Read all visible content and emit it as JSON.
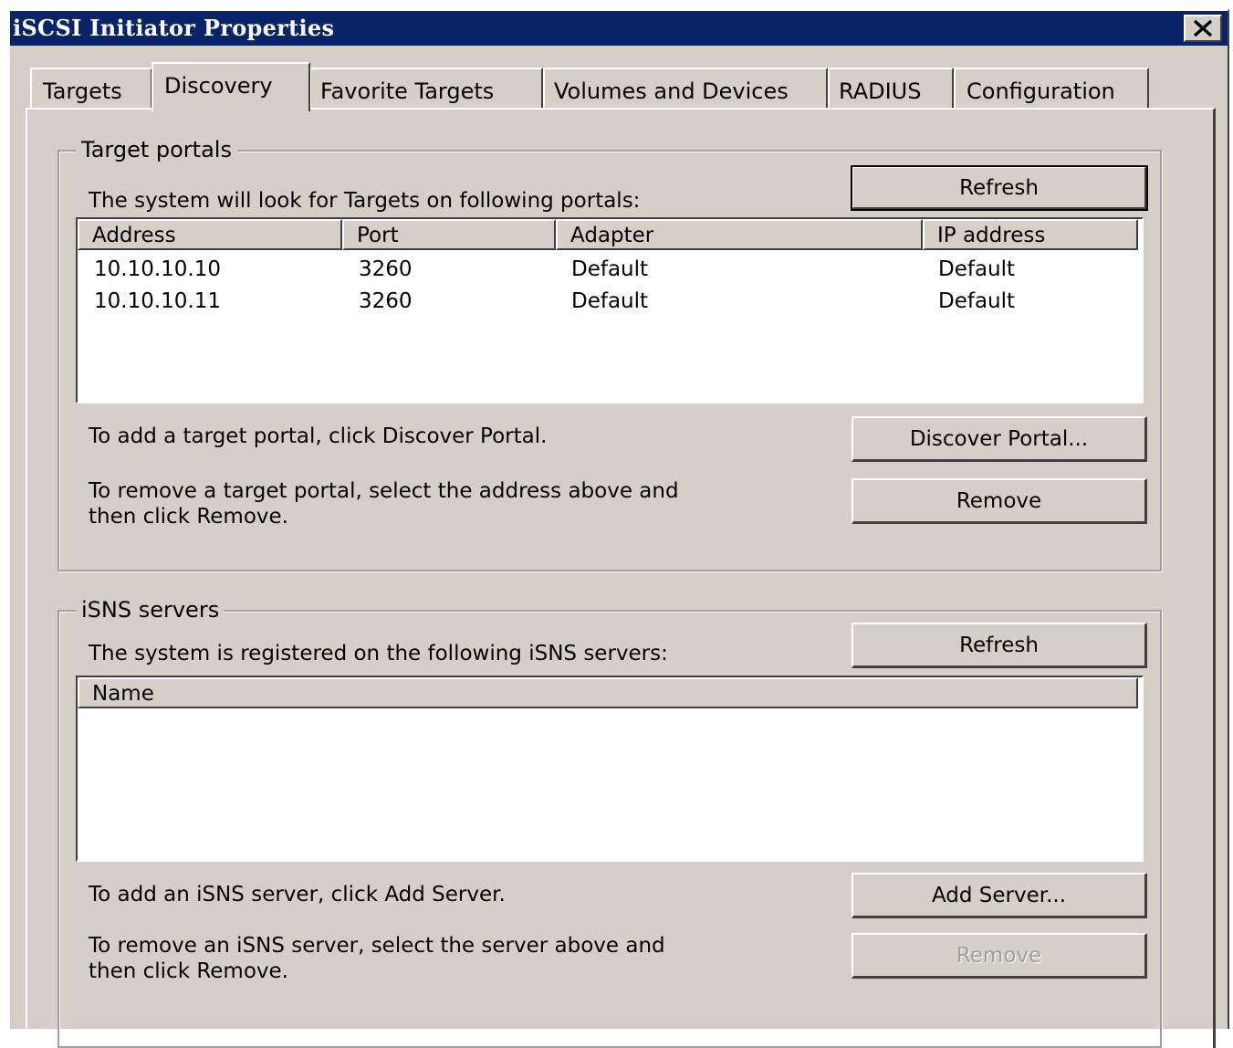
{
  "window": {
    "title": "iSCSI Initiator Properties",
    "close_glyph": "✕"
  },
  "tabs": [
    {
      "label": "Targets",
      "active": false
    },
    {
      "label": "Discovery",
      "active": true
    },
    {
      "label": "Favorite Targets",
      "active": false
    },
    {
      "label": "Volumes and Devices",
      "active": false
    },
    {
      "label": "RADIUS",
      "active": false
    },
    {
      "label": "Configuration",
      "active": false
    }
  ],
  "target_portals": {
    "legend": "Target portals",
    "description": "The system will look for Targets on following portals:",
    "refresh_label": "Refresh",
    "columns": [
      "Address",
      "Port",
      "Adapter",
      "IP address"
    ],
    "rows": [
      [
        "10.10.10.10",
        "3260",
        "Default",
        "Default"
      ],
      [
        "10.10.10.11",
        "3260",
        "Default",
        "Default"
      ]
    ],
    "add_hint": "To add a target portal, click Discover Portal.",
    "discover_label": "Discover Portal...",
    "remove_hint_line1": "To remove a target portal, select the address above and",
    "remove_hint_line2": "then click Remove.",
    "remove_label": "Remove"
  },
  "isns_servers": {
    "legend": "iSNS servers",
    "description": "The system is registered on the following iSNS servers:",
    "refresh_label": "Refresh",
    "columns": [
      "Name"
    ],
    "add_hint": "To add an iSNS server, click Add Server.",
    "add_label": "Add Server...",
    "remove_hint_line1": "To remove an iSNS server, select the server above and",
    "remove_hint_line2": "then click Remove.",
    "remove_label": "Remove",
    "remove_disabled": true
  }
}
